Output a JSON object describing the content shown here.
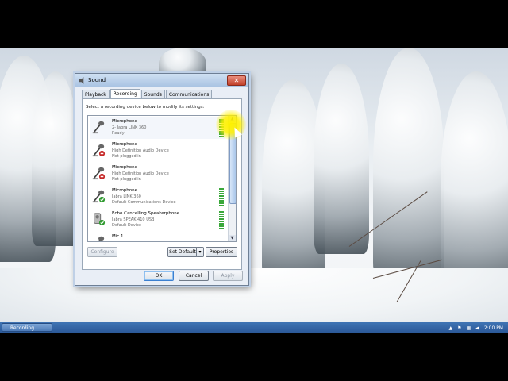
{
  "dialog": {
    "title": "Sound",
    "close_glyph": "✕",
    "tabs": [
      {
        "label": "Playback",
        "active": false
      },
      {
        "label": "Recording",
        "active": true
      },
      {
        "label": "Sounds",
        "active": false
      },
      {
        "label": "Communications",
        "active": false
      }
    ],
    "instruction": "Select a recording device below to modify its settings:",
    "devices": [
      {
        "name": "Microphone",
        "line1": "2- Jabra LINK 360",
        "line2": "Ready",
        "icon": "microphone-icon",
        "status": "none",
        "meter": true
      },
      {
        "name": "Microphone",
        "line1": "High Definition Audio Device",
        "line2": "Not plugged in",
        "icon": "microphone-icon",
        "status": "unplugged",
        "meter": false
      },
      {
        "name": "Microphone",
        "line1": "High Definition Audio Device",
        "line2": "Not plugged in",
        "icon": "microphone-icon",
        "status": "unplugged",
        "meter": false
      },
      {
        "name": "Microphone",
        "line1": "Jabra LINK 360",
        "line2": "Default Communications Device",
        "icon": "microphone-icon",
        "status": "default",
        "meter": true
      },
      {
        "name": "Echo Cancelling Speakerphone",
        "line1": "Jabra SPEAK 410 USB",
        "line2": "Default Device",
        "icon": "speakerphone-icon",
        "status": "default",
        "meter": true
      },
      {
        "name": "Mic 1",
        "line1": "",
        "line2": "",
        "icon": "microphone-icon",
        "status": "none",
        "meter": false
      }
    ],
    "buttons": {
      "configure": "Configure",
      "set_default": "Set Default",
      "properties": "Properties",
      "ok": "OK",
      "cancel": "Cancel",
      "apply": "Apply"
    }
  },
  "taskbar": {
    "task_label": "Recording...",
    "clock": "2:00 PM"
  },
  "colors": {
    "meter_green": "#3aa83a",
    "status_green": "#2f9a2f",
    "status_red": "#c62828",
    "taskbar_blue": "#2a5796"
  }
}
